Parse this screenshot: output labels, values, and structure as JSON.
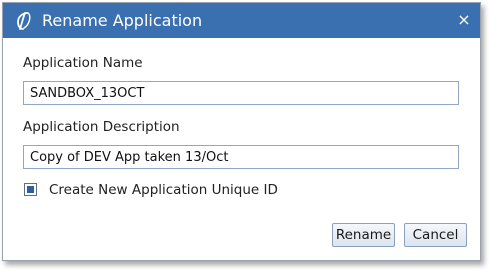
{
  "dialog": {
    "title": "Rename Application",
    "app_icon": "stylized-logo-icon",
    "close_icon": "close-icon",
    "close_glyph": "×"
  },
  "form": {
    "name_label": "Application Name",
    "name_value": "SANDBOX_13OCT",
    "description_label": "Application Description",
    "description_value": "Copy of DEV App taken 13/Oct",
    "unique_id_label": "Create New Application Unique ID",
    "unique_id_checked": true
  },
  "buttons": {
    "rename_label": "Rename",
    "cancel_label": "Cancel"
  },
  "colors": {
    "titlebar": "#3a6fb0",
    "checkbox_fill": "#2f5f9e"
  }
}
